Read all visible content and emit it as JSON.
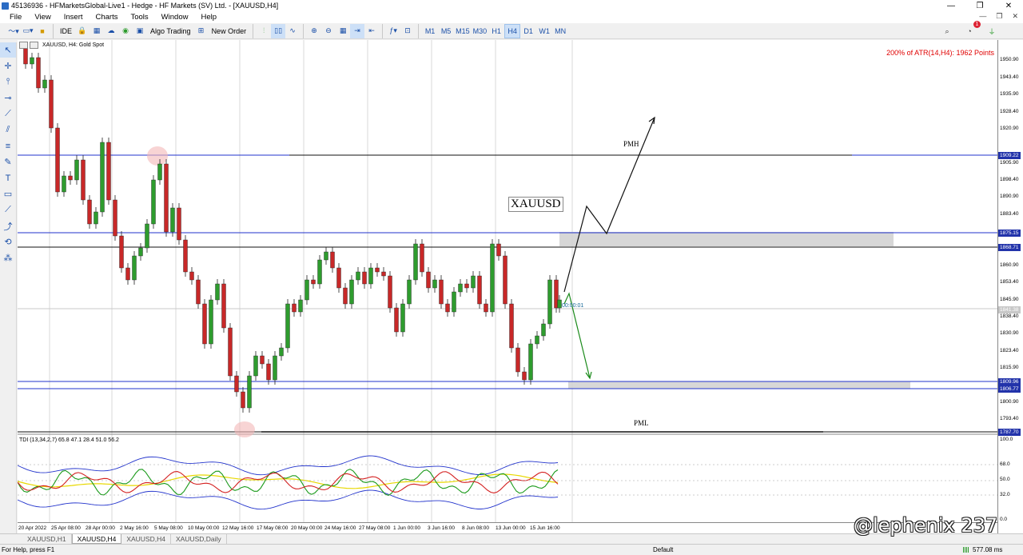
{
  "window": {
    "title": "45136936 - HFMarketsGlobal-Live1 - Hedge - HF Markets (SV) Ltd. - [XAUUSD,H4]"
  },
  "menu": [
    "File",
    "View",
    "Insert",
    "Charts",
    "Tools",
    "Window",
    "Help"
  ],
  "toolbar": {
    "ide_label": "IDE",
    "algo_label": "Algo Trading",
    "new_order_label": "New Order",
    "timeframes": [
      "M1",
      "M5",
      "M15",
      "M30",
      "H1",
      "H4",
      "D1",
      "W1",
      "MN"
    ],
    "active_timeframe": "H4",
    "notifications": "1"
  },
  "chart": {
    "symbol_label": "XAUUSD, H4:  Gold Spot",
    "atr_label": "200% of ATR(14,H4): 1962  Points",
    "box_label": "XAUUSD",
    "pmh_label": "PMH",
    "pml_label": "PML",
    "countdown": "00:00:01",
    "tdi_label": "TDI (13,34,2,7) 65.8 47.1 28.4 51.0 56.2",
    "price_labels": [
      "1950.90",
      "1943.40",
      "1935.90",
      "1928.40",
      "1920.90",
      "1905.90",
      "1898.40",
      "1890.90",
      "1883.40",
      "1860.90",
      "1853.40",
      "1845.90",
      "1838.40",
      "1830.90",
      "1823.40",
      "1815.90",
      "1800.90",
      "1793.40"
    ],
    "price_tags": [
      "1909.22",
      "1875.15",
      "1868.71",
      "1841.38",
      "1809.96",
      "1806.77",
      "1787.70"
    ],
    "tdi_scale": [
      "100.0",
      "68.0",
      "50.0",
      "32.0",
      "0.0"
    ],
    "dates": [
      "20 Apr 2022",
      "25 Apr 08:00",
      "28 Apr 00:00",
      "2 May 16:00",
      "5 May 08:00",
      "10 May 00:00",
      "12 May 16:00",
      "17 May 08:00",
      "20 May 00:00",
      "24 May 16:00",
      "27 May 08:00",
      "1 Jun 00:00",
      "3 Jun 16:00",
      "8 Jun 08:00",
      "13 Jun 00:00",
      "15 Jun 16:00"
    ]
  },
  "tabs": [
    "XAUUSD,H1",
    "XAUUSD,H4",
    "XAUUSD,H4",
    "XAUUSD,Daily"
  ],
  "active_tab": 1,
  "status": {
    "help": "For Help, press F1",
    "profile": "Default",
    "ping": "577.08 ms"
  },
  "watermark": "@lephenix 237",
  "colors": {
    "up": "#2e9c2e",
    "down": "#c82828",
    "level": "#2233cc",
    "atr": "#e00000"
  }
}
